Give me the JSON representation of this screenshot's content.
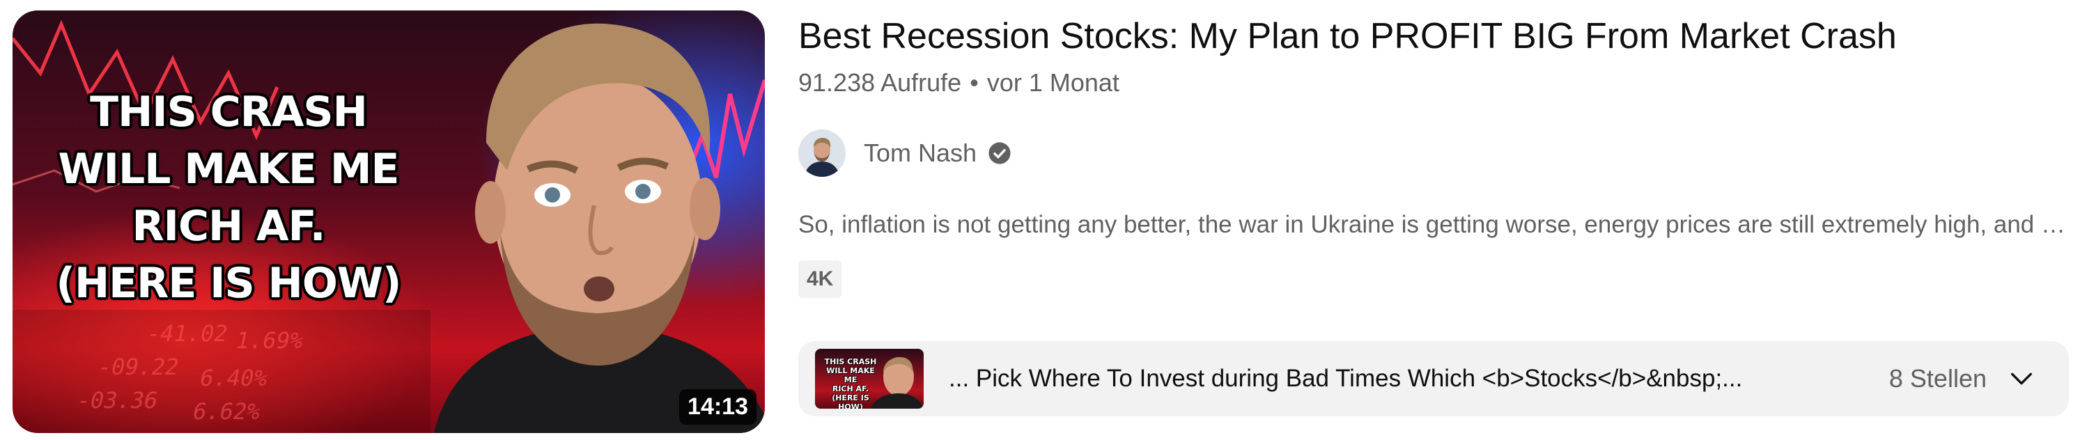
{
  "thumbnail": {
    "overlay_lines": [
      "THIS CRASH",
      "WILL MAKE ME",
      "RICH AF.",
      "(HERE IS HOW)"
    ],
    "ticker_numbers": [
      "-41.02",
      "-09.22",
      "-03.36",
      "6.40%",
      "6.62%",
      "1.69%"
    ],
    "duration": "14:13",
    "accent_red": "#c3121f",
    "accent_blue": "#2a5aff"
  },
  "video": {
    "title": "Best Recession Stocks: My Plan to PROFIT BIG From Market Crash",
    "views": "91.238 Aufrufe",
    "separator": "•",
    "age": "vor 1 Monat"
  },
  "channel": {
    "name": "Tom Nash",
    "verified_icon": "verified-check-icon"
  },
  "description": "So, inflation is not getting any better, the war in Ukraine is getting worse, energy prices are still extremely high, and there's a real chance of recession...",
  "badge": "4K",
  "chapters": {
    "thumbnail_lines": [
      "THIS CRASH",
      "WILL MAKE ME",
      "RICH AF.",
      "(HERE IS HOW)"
    ],
    "text": "... Pick Where To Invest during Bad Times Which <b>Stocks</b>&nbsp;...",
    "count": "8 Stellen",
    "expand_icon": "chevron-down-icon"
  }
}
